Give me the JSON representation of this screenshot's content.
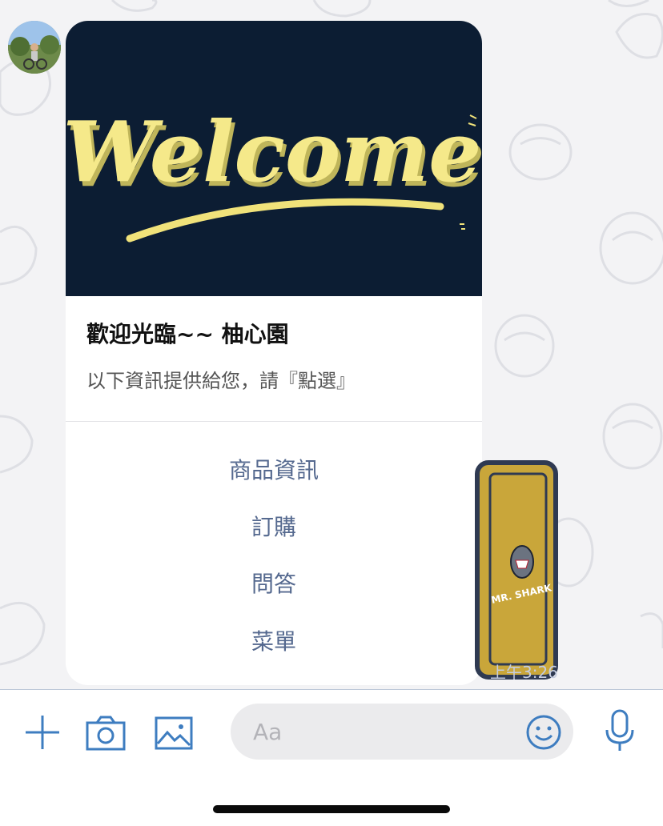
{
  "card": {
    "hero_text": "Welcome",
    "title": "歡迎光臨~~ 柚心園",
    "subtitle": "以下資訊提供給您，請『點選』",
    "actions": [
      {
        "label": "商品資訊"
      },
      {
        "label": "訂購"
      },
      {
        "label": "問答"
      },
      {
        "label": "菜單"
      }
    ]
  },
  "sticker": {
    "label": "MR. SHARK",
    "timestamp": "上午3:26"
  },
  "input_bar": {
    "placeholder": "Aa",
    "icons": [
      "plus-icon",
      "camera-icon",
      "image-icon",
      "emoji-icon",
      "microphone-icon"
    ]
  },
  "colors": {
    "accent": "#3e7dc0",
    "action_text": "#55698f",
    "hero_background": "#0c1d33",
    "hero_lettering": "#f5e98a",
    "sticker_body": "#c9a63a"
  }
}
